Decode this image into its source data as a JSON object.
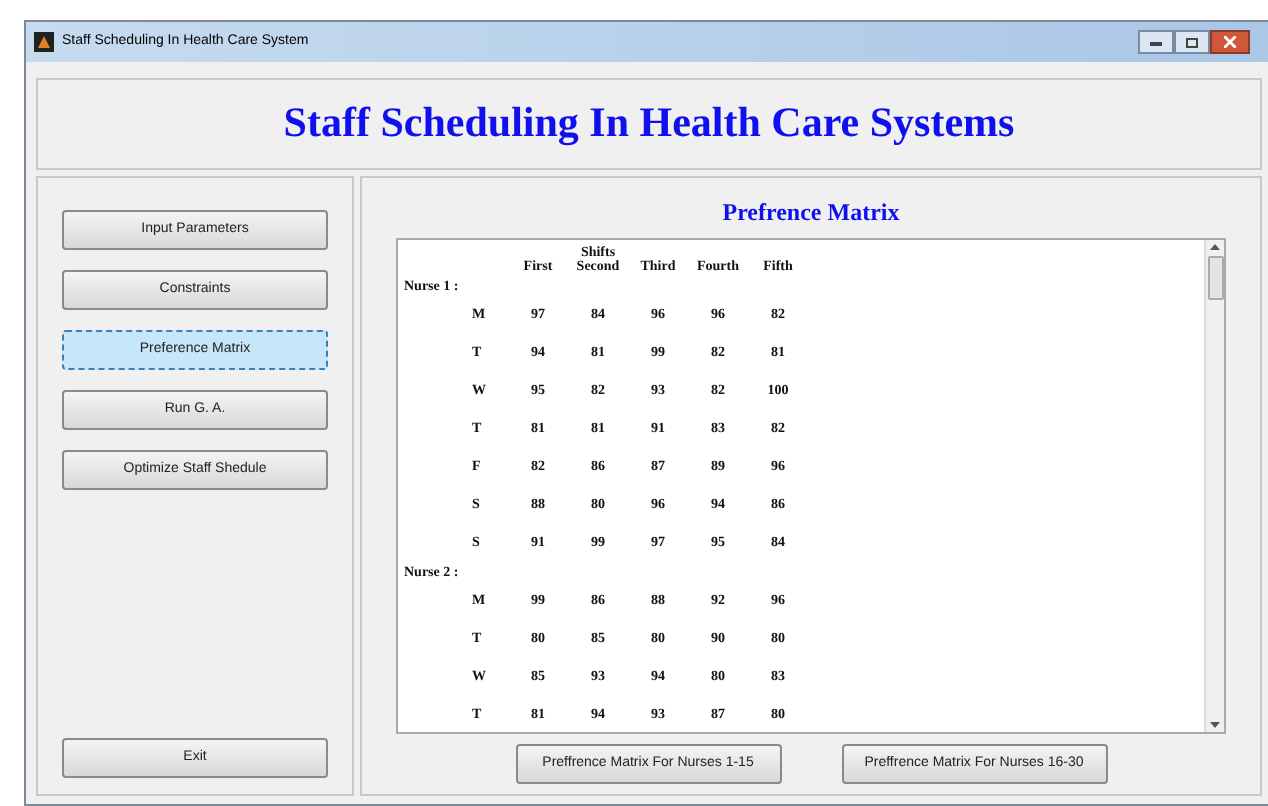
{
  "window": {
    "title": "Staff Scheduling In Health Care System"
  },
  "header": {
    "title": "Staff Scheduling In Health Care Systems"
  },
  "sidebar": {
    "items": [
      {
        "label": "Input Parameters",
        "selected": false
      },
      {
        "label": "Constraints",
        "selected": false
      },
      {
        "label": "Preference Matrix",
        "selected": true
      },
      {
        "label": "Run G. A.",
        "selected": false
      },
      {
        "label": "Optimize Staff Shedule",
        "selected": false
      }
    ],
    "exit_button": "Exit"
  },
  "panel": {
    "title": "Prefrence Matrix",
    "listbox": {
      "group_heading": "Shifts",
      "columns": [
        "First",
        "Second",
        "Third",
        "Fourth",
        "Fifth"
      ],
      "nurses": [
        {
          "label": "Nurse 1 :",
          "rows": [
            {
              "day": "M",
              "values": [
                "97",
                "84",
                "96",
                "96",
                "82"
              ]
            },
            {
              "day": "T",
              "values": [
                "94",
                "81",
                "99",
                "82",
                "81"
              ]
            },
            {
              "day": "W",
              "values": [
                "95",
                "82",
                "93",
                "82",
                "100"
              ]
            },
            {
              "day": "T",
              "values": [
                "81",
                "81",
                "91",
                "83",
                "82"
              ]
            },
            {
              "day": "F",
              "values": [
                "82",
                "86",
                "87",
                "89",
                "96"
              ]
            },
            {
              "day": "S",
              "values": [
                "88",
                "80",
                "96",
                "94",
                "86"
              ]
            },
            {
              "day": "S",
              "values": [
                "91",
                "99",
                "97",
                "95",
                "84"
              ]
            }
          ]
        },
        {
          "label": "Nurse 2 :",
          "rows": [
            {
              "day": "M",
              "values": [
                "99",
                "86",
                "88",
                "92",
                "96"
              ]
            },
            {
              "day": "T",
              "values": [
                "80",
                "85",
                "80",
                "90",
                "80"
              ]
            },
            {
              "day": "W",
              "values": [
                "85",
                "93",
                "94",
                "80",
                "83"
              ]
            },
            {
              "day": "T",
              "values": [
                "81",
                "94",
                "93",
                "87",
                "80"
              ]
            }
          ]
        }
      ]
    },
    "buttons": [
      "Preffrence Matrix For Nurses 1-15",
      "Preffrence Matrix For Nurses 16-30"
    ]
  }
}
